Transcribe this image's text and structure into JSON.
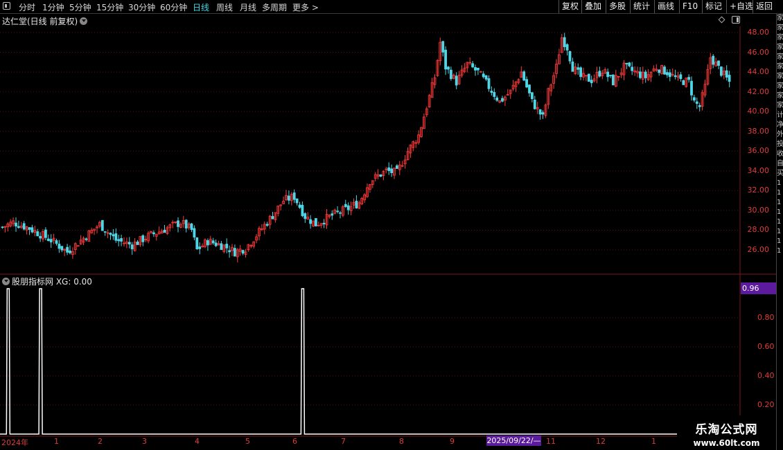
{
  "toolbar": {
    "periods": [
      "分时",
      "1分钟",
      "5分钟",
      "15分钟",
      "30分钟",
      "60分钟",
      "日线",
      "周线",
      "月线",
      "多周期",
      "更多 >"
    ],
    "active_period": "日线",
    "right_buttons": [
      "复权",
      "叠加",
      "多股",
      "统计",
      "画线",
      "F10",
      "标记",
      "+自选",
      "返回"
    ]
  },
  "chart": {
    "title": "达仁堂(日线 前复权)",
    "price_axis": [
      "48.00",
      "46.00",
      "44.00",
      "42.00",
      "40.00",
      "38.00",
      "36.00",
      "34.00",
      "32.00",
      "30.00",
      "28.00",
      "26.00"
    ],
    "up_color": "#ff3b3b",
    "down_color": "#4fd6e6"
  },
  "indicator": {
    "title": "股朋指标网 XG: 0.00",
    "current_value": "0.96",
    "axis": [
      "0.80",
      "0.60",
      "0.40",
      "0.20"
    ],
    "signals_at_candle": [
      2,
      14,
      111
    ]
  },
  "date_axis": {
    "labels": [
      "2024年",
      "1",
      "2",
      "3",
      "4",
      "5",
      "6",
      "7",
      "8",
      "9",
      "11",
      "12",
      "1"
    ],
    "cursor_date": "2025/09/22/—"
  },
  "watermark": {
    "line1": "乐淘公式网",
    "line2": "www.60lt.com"
  },
  "right_strip": [
    "家",
    "家",
    "家",
    "家",
    "家",
    "家",
    "家",
    "家",
    "家",
    "家",
    "计",
    "净",
    "外",
    "投",
    "收",
    "自",
    "买",
    "1",
    "1",
    "1",
    "1",
    "1",
    "1",
    "1",
    "1"
  ]
}
